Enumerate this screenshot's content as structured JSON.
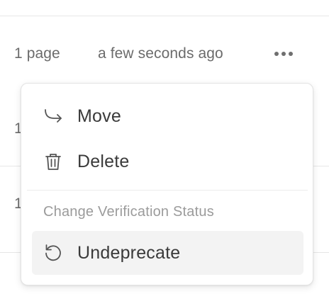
{
  "list": {
    "row1": {
      "pages": "1 page",
      "updated": "a few seconds ago"
    },
    "row2_prefix": "1",
    "row3_prefix": "1",
    "more_icon": "more-horizontal-icon"
  },
  "menu": {
    "items": [
      {
        "label": "Move",
        "icon": "arrow-move-icon"
      },
      {
        "label": "Delete",
        "icon": "trash-icon"
      }
    ],
    "section_label": "Change Verification Status",
    "section_items": [
      {
        "label": "Undeprecate",
        "icon": "rotate-ccw-icon"
      }
    ]
  }
}
